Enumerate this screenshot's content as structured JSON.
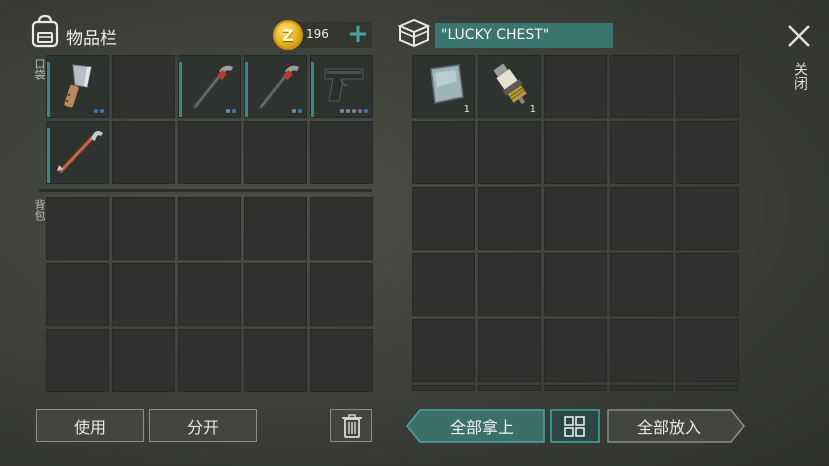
{
  "inventory": {
    "title": "物品栏",
    "icon": "backpack-icon",
    "pocket_label": "口袋",
    "backpack_label": "背包",
    "coins": "196",
    "coin_symbol": "Z",
    "add_coins": "+",
    "pocket_items": [
      {
        "name": "cleaver",
        "dots": [
          "#3b78b8",
          "#3b78b8"
        ]
      },
      {
        "name": "crowbar-red",
        "dots": [
          "#7d8a9a",
          "#3b78b8"
        ]
      },
      {
        "name": "crowbar-red",
        "dots": [
          "#7d8a9a",
          "#3b78b8"
        ]
      },
      {
        "name": "pistol",
        "dots": [
          "#7d8a9a",
          "#7d8a9a",
          "#7d8a9a",
          "#9b59b6",
          "#3b78b8"
        ]
      },
      {
        "name": "crowbar-rusty",
        "dots": []
      }
    ]
  },
  "chest": {
    "name": "\"LUCKY CHEST\"",
    "icon": "chest-icon",
    "items": [
      {
        "name": "metal-plate",
        "qty": "1"
      },
      {
        "name": "spark-plug",
        "qty": "1"
      }
    ]
  },
  "close": {
    "icon": "close-icon",
    "label": "关闭"
  },
  "buttons": {
    "use": "使用",
    "split": "分开",
    "take_all": "全部拿上",
    "put_all": "全部放入",
    "trash_icon": "trash-icon",
    "sort_icon": "grid-icon"
  },
  "colors": {
    "accent": "#3a8f87",
    "rarity_bar": "#2e8d86",
    "chest_name_bg": "#3a7570"
  }
}
